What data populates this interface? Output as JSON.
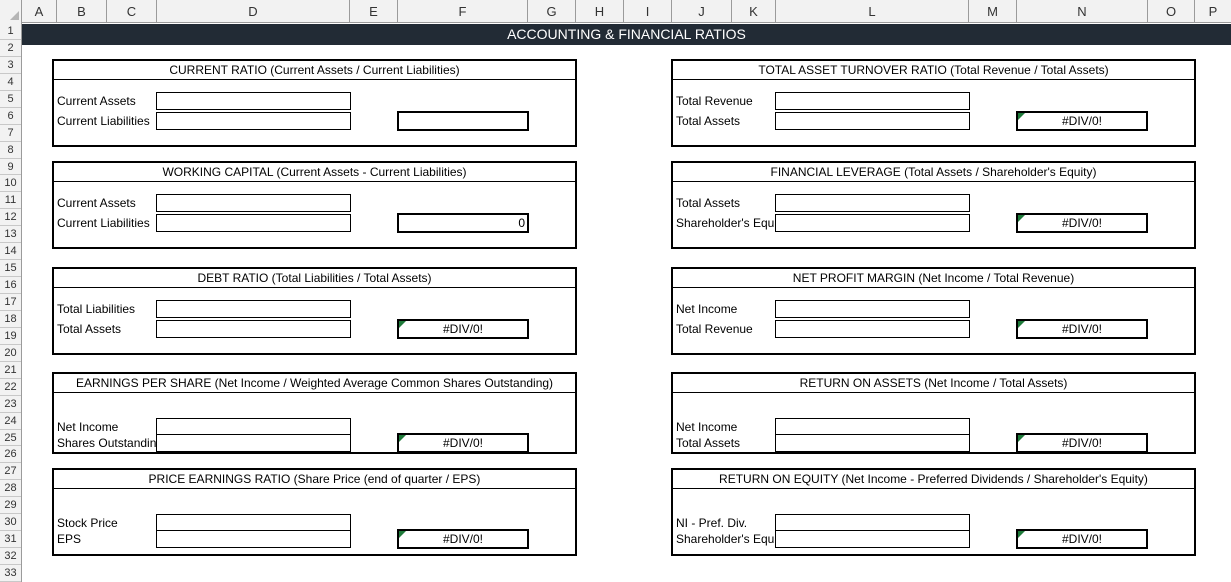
{
  "columns": [
    "A",
    "B",
    "C",
    "D",
    "E",
    "F",
    "G",
    "H",
    "I",
    "J",
    "K",
    "L",
    "M",
    "N",
    "O",
    "P"
  ],
  "rows": [
    "1",
    "2",
    "3",
    "4",
    "5",
    "6",
    "7",
    "8",
    "9",
    "10",
    "11",
    "12",
    "13",
    "14",
    "15",
    "16",
    "17",
    "18",
    "19",
    "20",
    "21",
    "22",
    "23",
    "24",
    "25",
    "26",
    "27",
    "28",
    "29",
    "30",
    "31",
    "32",
    "33"
  ],
  "banner": "ACCOUNTING & FINANCIAL RATIOS",
  "left_boxes": [
    {
      "title": "CURRENT RATIO (Current Assets / Current Liabilities)",
      "label1": "Current Assets",
      "label2": "Current Liabilities",
      "result": ""
    },
    {
      "title": "WORKING CAPITAL (Current Assets - Current Liabilities)",
      "label1": "Current Assets",
      "label2": "Current Liabilities",
      "result": "0"
    },
    {
      "title": "DEBT RATIO (Total Liabilities / Total Assets)",
      "label1": "Total Liabilities",
      "label2": "Total Assets",
      "result": "#DIV/0!"
    },
    {
      "title": "EARNINGS PER SHARE (Net Income / Weighted Average Common Shares Outstanding)",
      "label1": "Net Income",
      "label2": "Shares Outstanding",
      "result": "#DIV/0!"
    },
    {
      "title": "PRICE EARNINGS RATIO (Share Price (end of quarter / EPS)",
      "label1": "Stock Price",
      "label2": "EPS",
      "result": "#DIV/0!"
    }
  ],
  "right_boxes": [
    {
      "title": "TOTAL ASSET TURNOVER RATIO (Total Revenue / Total Assets)",
      "label1": "Total Revenue",
      "label2": "Total Assets",
      "result": "#DIV/0!"
    },
    {
      "title": "FINANCIAL LEVERAGE (Total Assets / Shareholder's Equity)",
      "label1": "Total Assets",
      "label2": "Shareholder's Equity",
      "result": "#DIV/0!"
    },
    {
      "title": "NET PROFIT MARGIN (Net Income / Total Revenue)",
      "label1": "Net Income",
      "label2": "Total Revenue",
      "result": "#DIV/0!"
    },
    {
      "title": "RETURN ON ASSETS (Net Income / Total Assets)",
      "label1": "Net Income",
      "label2": "Total Assets",
      "result": "#DIV/0!"
    },
    {
      "title": "RETURN ON EQUITY (Net Income - Preferred Dividends / Shareholder's Equity)",
      "label1": "NI - Pref. Div.",
      "label2": "Shareholder's Equity",
      "result": "#DIV/0!"
    }
  ],
  "colors": {
    "banner_bg": "#222b35",
    "banner_text": "#ffffff",
    "error_flag": "#1e7a3a",
    "header_bg": "#f2f2f2"
  }
}
